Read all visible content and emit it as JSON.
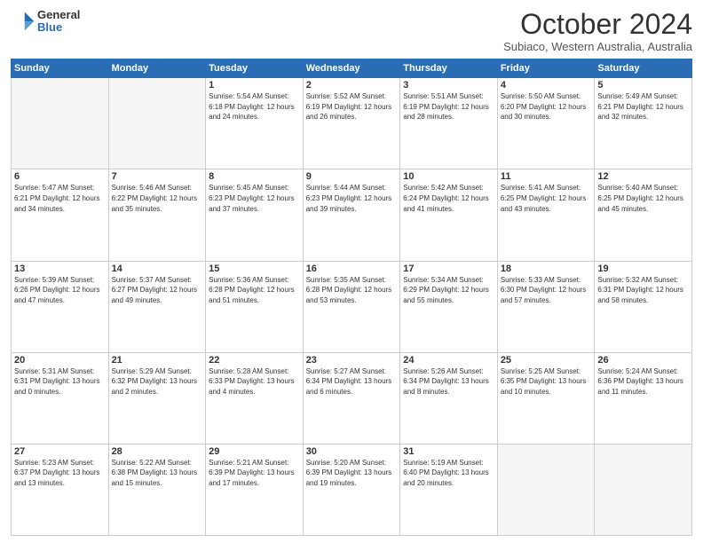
{
  "logo": {
    "general": "General",
    "blue": "Blue"
  },
  "title": "October 2024",
  "location": "Subiaco, Western Australia, Australia",
  "days_of_week": [
    "Sunday",
    "Monday",
    "Tuesday",
    "Wednesday",
    "Thursday",
    "Friday",
    "Saturday"
  ],
  "weeks": [
    [
      {
        "day": "",
        "info": ""
      },
      {
        "day": "",
        "info": ""
      },
      {
        "day": "1",
        "info": "Sunrise: 5:54 AM\nSunset: 6:18 PM\nDaylight: 12 hours\nand 24 minutes."
      },
      {
        "day": "2",
        "info": "Sunrise: 5:52 AM\nSunset: 6:19 PM\nDaylight: 12 hours\nand 26 minutes."
      },
      {
        "day": "3",
        "info": "Sunrise: 5:51 AM\nSunset: 6:19 PM\nDaylight: 12 hours\nand 28 minutes."
      },
      {
        "day": "4",
        "info": "Sunrise: 5:50 AM\nSunset: 6:20 PM\nDaylight: 12 hours\nand 30 minutes."
      },
      {
        "day": "5",
        "info": "Sunrise: 5:49 AM\nSunset: 6:21 PM\nDaylight: 12 hours\nand 32 minutes."
      }
    ],
    [
      {
        "day": "6",
        "info": "Sunrise: 5:47 AM\nSunset: 6:21 PM\nDaylight: 12 hours\nand 34 minutes."
      },
      {
        "day": "7",
        "info": "Sunrise: 5:46 AM\nSunset: 6:22 PM\nDaylight: 12 hours\nand 35 minutes."
      },
      {
        "day": "8",
        "info": "Sunrise: 5:45 AM\nSunset: 6:23 PM\nDaylight: 12 hours\nand 37 minutes."
      },
      {
        "day": "9",
        "info": "Sunrise: 5:44 AM\nSunset: 6:23 PM\nDaylight: 12 hours\nand 39 minutes."
      },
      {
        "day": "10",
        "info": "Sunrise: 5:42 AM\nSunset: 6:24 PM\nDaylight: 12 hours\nand 41 minutes."
      },
      {
        "day": "11",
        "info": "Sunrise: 5:41 AM\nSunset: 6:25 PM\nDaylight: 12 hours\nand 43 minutes."
      },
      {
        "day": "12",
        "info": "Sunrise: 5:40 AM\nSunset: 6:25 PM\nDaylight: 12 hours\nand 45 minutes."
      }
    ],
    [
      {
        "day": "13",
        "info": "Sunrise: 5:39 AM\nSunset: 6:26 PM\nDaylight: 12 hours\nand 47 minutes."
      },
      {
        "day": "14",
        "info": "Sunrise: 5:37 AM\nSunset: 6:27 PM\nDaylight: 12 hours\nand 49 minutes."
      },
      {
        "day": "15",
        "info": "Sunrise: 5:36 AM\nSunset: 6:28 PM\nDaylight: 12 hours\nand 51 minutes."
      },
      {
        "day": "16",
        "info": "Sunrise: 5:35 AM\nSunset: 6:28 PM\nDaylight: 12 hours\nand 53 minutes."
      },
      {
        "day": "17",
        "info": "Sunrise: 5:34 AM\nSunset: 6:29 PM\nDaylight: 12 hours\nand 55 minutes."
      },
      {
        "day": "18",
        "info": "Sunrise: 5:33 AM\nSunset: 6:30 PM\nDaylight: 12 hours\nand 57 minutes."
      },
      {
        "day": "19",
        "info": "Sunrise: 5:32 AM\nSunset: 6:31 PM\nDaylight: 12 hours\nand 58 minutes."
      }
    ],
    [
      {
        "day": "20",
        "info": "Sunrise: 5:31 AM\nSunset: 6:31 PM\nDaylight: 13 hours\nand 0 minutes."
      },
      {
        "day": "21",
        "info": "Sunrise: 5:29 AM\nSunset: 6:32 PM\nDaylight: 13 hours\nand 2 minutes."
      },
      {
        "day": "22",
        "info": "Sunrise: 5:28 AM\nSunset: 6:33 PM\nDaylight: 13 hours\nand 4 minutes."
      },
      {
        "day": "23",
        "info": "Sunrise: 5:27 AM\nSunset: 6:34 PM\nDaylight: 13 hours\nand 6 minutes."
      },
      {
        "day": "24",
        "info": "Sunrise: 5:26 AM\nSunset: 6:34 PM\nDaylight: 13 hours\nand 8 minutes."
      },
      {
        "day": "25",
        "info": "Sunrise: 5:25 AM\nSunset: 6:35 PM\nDaylight: 13 hours\nand 10 minutes."
      },
      {
        "day": "26",
        "info": "Sunrise: 5:24 AM\nSunset: 6:36 PM\nDaylight: 13 hours\nand 11 minutes."
      }
    ],
    [
      {
        "day": "27",
        "info": "Sunrise: 5:23 AM\nSunset: 6:37 PM\nDaylight: 13 hours\nand 13 minutes."
      },
      {
        "day": "28",
        "info": "Sunrise: 5:22 AM\nSunset: 6:38 PM\nDaylight: 13 hours\nand 15 minutes."
      },
      {
        "day": "29",
        "info": "Sunrise: 5:21 AM\nSunset: 6:39 PM\nDaylight: 13 hours\nand 17 minutes."
      },
      {
        "day": "30",
        "info": "Sunrise: 5:20 AM\nSunset: 6:39 PM\nDaylight: 13 hours\nand 19 minutes."
      },
      {
        "day": "31",
        "info": "Sunrise: 5:19 AM\nSunset: 6:40 PM\nDaylight: 13 hours\nand 20 minutes."
      },
      {
        "day": "",
        "info": ""
      },
      {
        "day": "",
        "info": ""
      }
    ]
  ]
}
